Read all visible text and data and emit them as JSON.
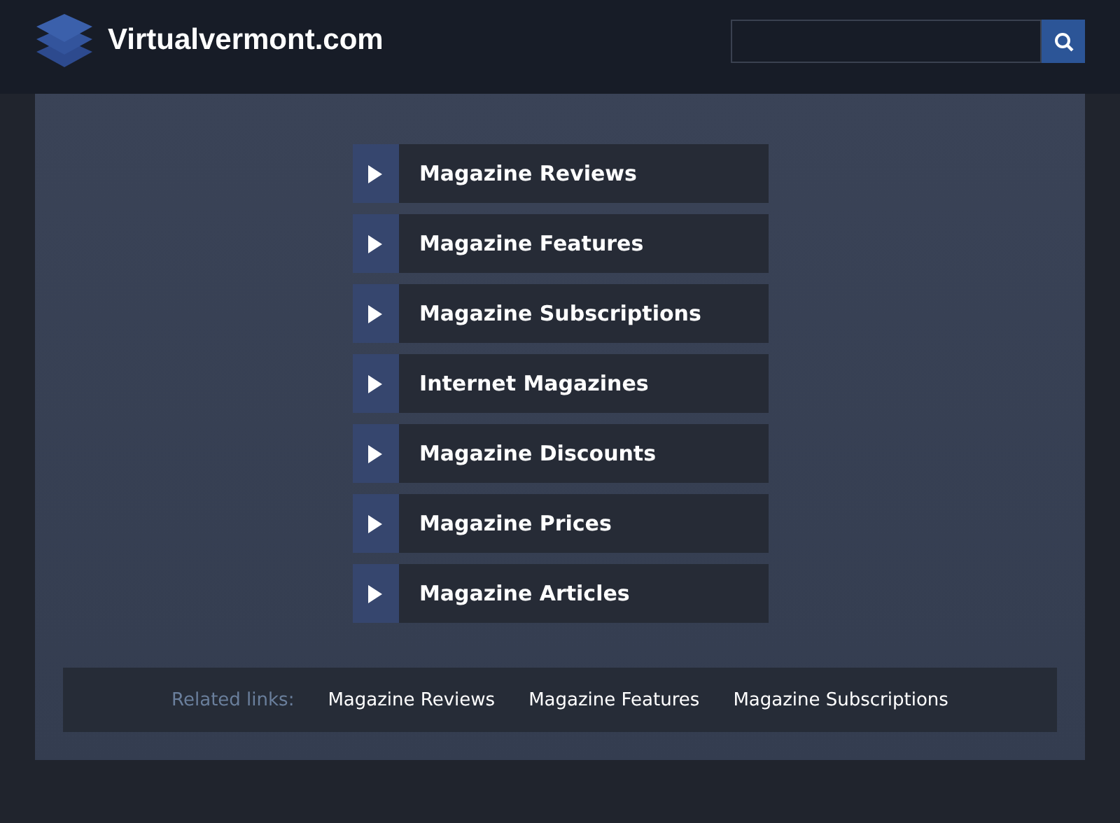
{
  "header": {
    "site_name": "Virtualvermont.com"
  },
  "menu": [
    {
      "label": "Magazine Reviews"
    },
    {
      "label": "Magazine Features"
    },
    {
      "label": "Magazine Subscriptions"
    },
    {
      "label": "Internet Magazines"
    },
    {
      "label": "Magazine Discounts"
    },
    {
      "label": "Magazine Prices"
    },
    {
      "label": "Magazine Articles"
    }
  ],
  "related": {
    "label": "Related links:",
    "links": [
      "Magazine Reviews",
      "Magazine Features",
      "Magazine Subscriptions"
    ]
  }
}
